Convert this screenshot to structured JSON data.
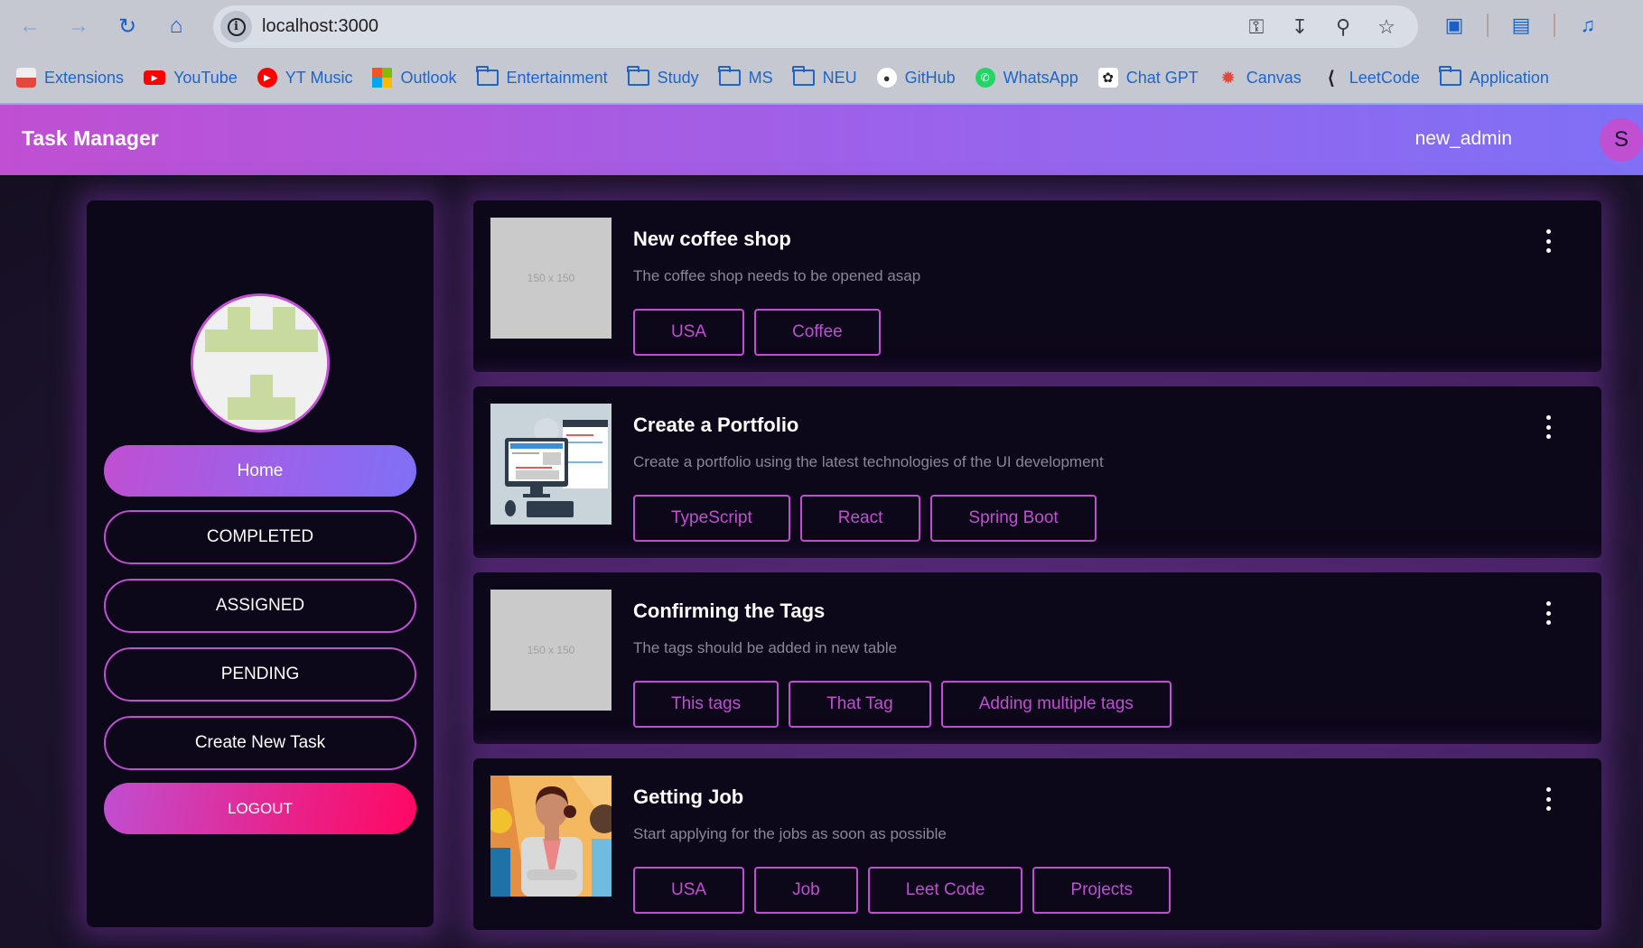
{
  "browser": {
    "url": "localhost:3000",
    "bookmarks": [
      {
        "label": "Extensions",
        "icon": "chrome-extensions-icon"
      },
      {
        "label": "YouTube",
        "icon": "youtube-icon"
      },
      {
        "label": "YT Music",
        "icon": "yt-music-icon"
      },
      {
        "label": "Outlook",
        "icon": "microsoft-icon"
      },
      {
        "label": "Entertainment",
        "icon": "folder-icon"
      },
      {
        "label": "Study",
        "icon": "folder-icon"
      },
      {
        "label": "MS",
        "icon": "folder-icon"
      },
      {
        "label": "NEU",
        "icon": "folder-icon"
      },
      {
        "label": "GitHub",
        "icon": "github-icon"
      },
      {
        "label": "WhatsApp",
        "icon": "whatsapp-icon"
      },
      {
        "label": "Chat GPT",
        "icon": "chatgpt-icon"
      },
      {
        "label": "Canvas",
        "icon": "canvas-icon"
      },
      {
        "label": "LeetCode",
        "icon": "leetcode-icon"
      },
      {
        "label": "Application",
        "icon": "folder-icon"
      }
    ]
  },
  "header": {
    "title": "Task Manager",
    "username": "new_admin",
    "avatar_initial": "S"
  },
  "sidebar": {
    "items": [
      {
        "label": "Home",
        "active": true
      },
      {
        "label": "COMPLETED"
      },
      {
        "label": "ASSIGNED"
      },
      {
        "label": "PENDING"
      },
      {
        "label": "Create New Task"
      },
      {
        "label": "LOGOUT"
      }
    ]
  },
  "tasks": [
    {
      "title": "New coffee shop",
      "description": "The coffee shop needs to be opened asap",
      "image": "placeholder",
      "placeholder_text": "150 x 150",
      "tags": [
        "USA",
        "Coffee"
      ]
    },
    {
      "title": "Create a Portfolio",
      "description": "Create a portfolio using the latest technologies of the UI development",
      "image": "computer-illustration",
      "tags": [
        "TypeScript",
        "React",
        "Spring Boot"
      ]
    },
    {
      "title": "Confirming the Tags",
      "description": "The tags should be added in new table",
      "image": "placeholder",
      "placeholder_text": "150 x 150",
      "tags": [
        "This tags",
        "That Tag",
        "Adding multiple tags"
      ]
    },
    {
      "title": "Getting Job",
      "description": "Start applying for the jobs as soon as possible",
      "image": "professionals-illustration",
      "tags": [
        "USA",
        "Job",
        "Leet Code",
        "Projects"
      ]
    }
  ],
  "colors": {
    "accent": "#c04fd2",
    "header_gradient_end": "#7f70f6",
    "logout_end": "#ff0862",
    "card_bg": "#0c0719"
  }
}
